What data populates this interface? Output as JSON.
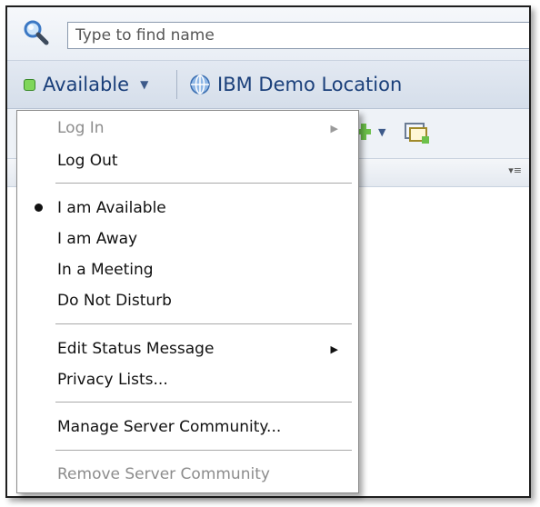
{
  "search": {
    "placeholder": "Type to find name"
  },
  "status_bar": {
    "status_label": "Available",
    "location_label": "IBM Demo Location",
    "colors": {
      "available": "#7fd65a",
      "text": "#1a3f7a"
    }
  },
  "menu": {
    "items": [
      {
        "label": "Log In",
        "disabled": true,
        "submenu": true
      },
      {
        "label": "Log Out",
        "disabled": false
      },
      {
        "label": "I am Available",
        "selected": true
      },
      {
        "label": "I am Away"
      },
      {
        "label": "In a Meeting"
      },
      {
        "label": "Do Not Disturb"
      },
      {
        "label": "Edit Status Message",
        "submenu": true
      },
      {
        "label": "Privacy Lists..."
      },
      {
        "label": "Manage Server Community..."
      },
      {
        "label": "Remove Server Community",
        "disabled": true
      }
    ]
  },
  "icons": [
    "search-icon",
    "status-available-icon",
    "globe-icon",
    "add-contact-icon",
    "new-chat-icon",
    "column-menu-icon"
  ]
}
